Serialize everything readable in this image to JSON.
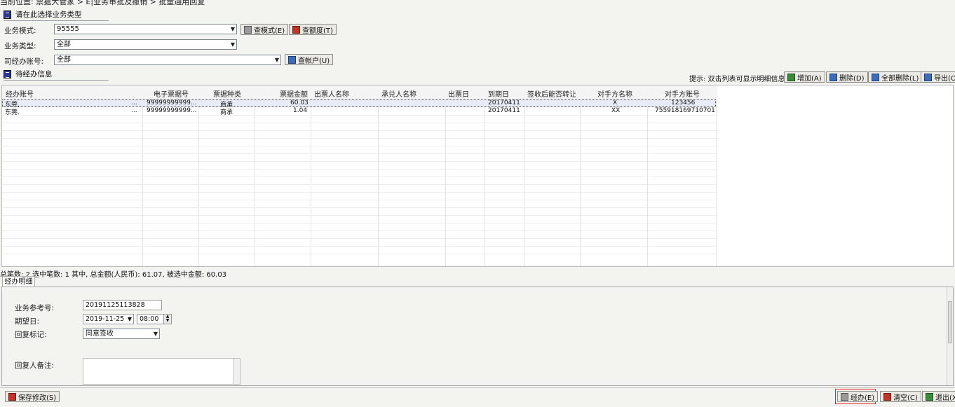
{
  "breadcrumb": "当前位置: 票据大管家 > E|业务审批及撤销 > 批量通用回复",
  "section1": {
    "title": "请在此选择业务类型"
  },
  "form": {
    "business_mode": {
      "label": "业务模式:",
      "value": "95555"
    },
    "business_type": {
      "label": "业务类型:",
      "value": "全部"
    },
    "account": {
      "label": "司经办账号:",
      "value": "全部"
    },
    "btn_query_mode": "查模式(E)",
    "btn_query_quota": "查额度(T)",
    "btn_query_account": "查帐户(U)"
  },
  "section2": {
    "title": "待经办信息"
  },
  "toolbar": {
    "hint": "提示: 双击列表可显示明细信息",
    "add": "增加(A)",
    "delete": "删除(D)",
    "delete_all": "全部删除(L)",
    "export": "导出(O)"
  },
  "table": {
    "columns": [
      "经办账号",
      "电子票据号",
      "票据种类",
      "票据金额",
      "出票人名称",
      "承兑人名称",
      "出票日",
      "到期日",
      "签收后能否转让",
      "对手方名称",
      "对手方账号"
    ],
    "rows": [
      {
        "account": "东莞.",
        "more": "...",
        "bill_no": "99999999999...",
        "type": "商承",
        "amount": "60.03",
        "drawer": "",
        "acceptor": "",
        "issue_date": "",
        "due_date": "20170411",
        "transferable": "",
        "cp_name": "X",
        "cp_account": "123456"
      },
      {
        "account": "东莞.",
        "more": "...",
        "bill_no": "99999999999...",
        "type": "商承",
        "amount": "1.04",
        "drawer": "",
        "acceptor": "",
        "issue_date": "",
        "due_date": "20170411",
        "transferable": "",
        "cp_name": "XX",
        "cp_account": "755918169710701"
      }
    ]
  },
  "status": "总笔数: 2  选中笔数: 1  其中, 总金额(人民币): 61.07, 被选中金额: 60.03",
  "detail_tab": "经办明细",
  "detail": {
    "ref_label": "业务参考号:",
    "ref_value": "20191125113828",
    "date_label": "期望日:",
    "date_value": "2019-11-25",
    "time_value": "08:00",
    "reply_flag_label": "回复标记:",
    "reply_flag_value": "同意签收",
    "remark_label": "回复人备注:"
  },
  "bottom": {
    "save": "保存修改(S)",
    "submit": "经办(E)",
    "clear": "清空(C)",
    "exit": "退出(X)"
  }
}
